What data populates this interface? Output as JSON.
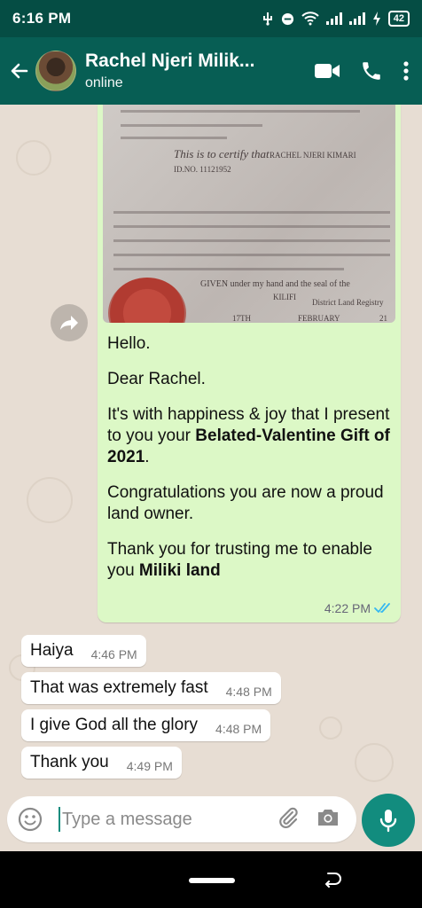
{
  "status_bar": {
    "time": "6:16 PM",
    "battery": "42"
  },
  "header": {
    "contact_name": "Rachel Njeri Milik...",
    "presence": "online",
    "icons": [
      "back-arrow-icon",
      "video-call-icon",
      "phone-icon",
      "more-options-icon"
    ]
  },
  "document_image": {
    "cert_line": "This is to certify that",
    "name_line": "RACHEL NJERI KIMARI",
    "id_line": "ID.NO. 11121952",
    "given_line": "GIVEN under my hand and the seal of the",
    "place": "KILIFI",
    "registry": "District Land Registry",
    "day": "17TH",
    "month": "FEBRUARY",
    "year": "21"
  },
  "outgoing_message": {
    "greeting": "Hello.",
    "salutation": "Dear Rachel.",
    "line1_plain": "It's with happiness & joy that I present to you your ",
    "line1_bold": "Belated-Valentine Gift of 2021",
    "line1_end": ".",
    "line2": "Congratulations you are now a proud land owner.",
    "line3_plain": "Thank you for trusting me to enable you ",
    "line3_bold": "Miliki land",
    "time": "4:22 PM"
  },
  "incoming_messages": [
    {
      "text": "Haiya",
      "time": "4:46 PM"
    },
    {
      "text": "That was extremely fast",
      "time": "4:48 PM"
    },
    {
      "text": "I give God all the glory",
      "time": "4:48 PM"
    },
    {
      "text": "Thank you",
      "time": "4:49 PM"
    }
  ],
  "composer": {
    "placeholder": "Type a message"
  },
  "colors": {
    "header": "#075e54",
    "accent": "#128c7e",
    "outgoing_bubble": "#dcf8c6",
    "read_ticks": "#34b7f1"
  }
}
